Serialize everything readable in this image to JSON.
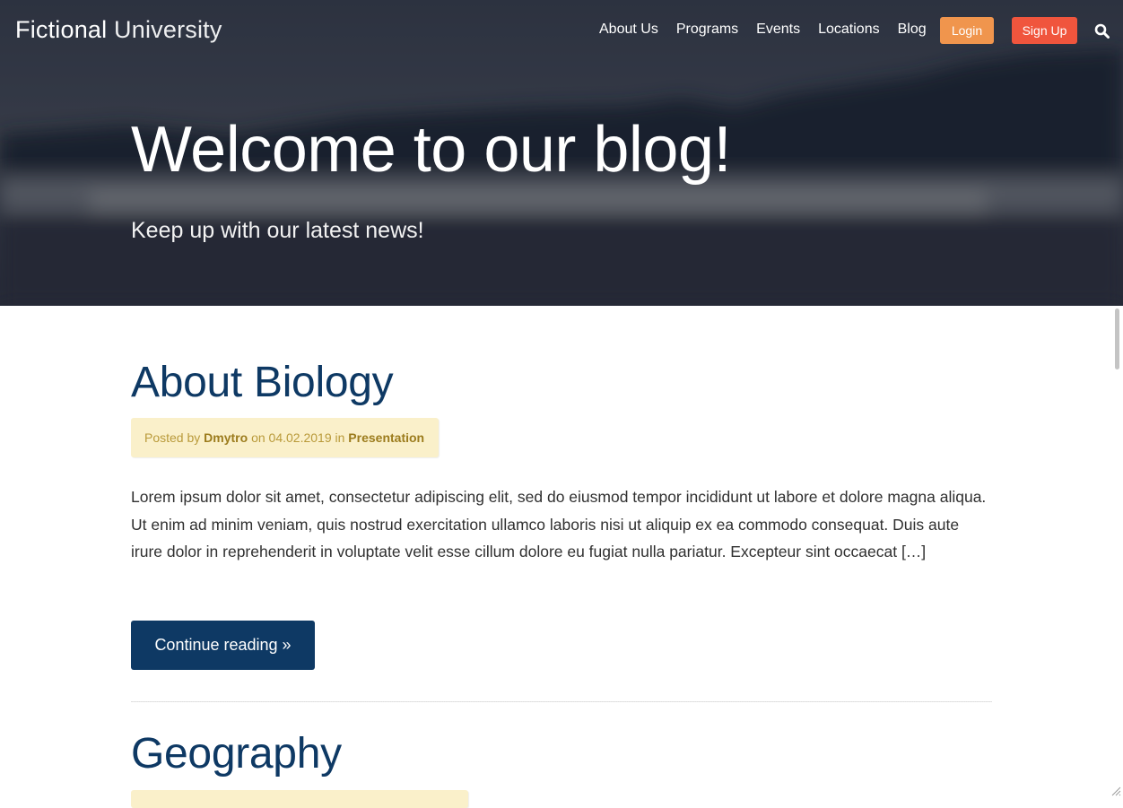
{
  "header": {
    "logo_strong": "Fictional",
    "logo_light": "University",
    "nav": [
      "About Us",
      "Programs",
      "Events",
      "Locations",
      "Blog"
    ],
    "login_label": "Login",
    "signup_label": "Sign Up",
    "search_icon": "search-icon"
  },
  "hero": {
    "title": "Welcome to our blog!",
    "subtitle": "Keep up with our latest news!"
  },
  "posts": [
    {
      "title": "About Biology",
      "meta": {
        "posted_by": "Posted by",
        "author": "Dmytro",
        "on": "on",
        "date": "04.02.2019",
        "in": "in",
        "category": "Presentation"
      },
      "excerpt": "Lorem ipsum dolor sit amet, consectetur adipiscing elit, sed do eiusmod tempor incididunt ut labore et dolore magna aliqua. Ut enim ad minim veniam, quis nostrud exercitation ullamco laboris nisi ut aliquip ex ea commodo consequat. Duis aute irure dolor in reprehenderit in voluptate velit esse cillum dolore eu fugiat nulla pariatur. Excepteur sint occaecat […]",
      "continue_label": "Continue reading »"
    },
    {
      "title": "Geography"
    }
  ],
  "colors": {
    "navy": "#0e3964",
    "login_orange": "#f0954d",
    "signup_red": "#f0553d",
    "meta_bg": "#faf0ca",
    "meta_text": "#b99a3a"
  }
}
